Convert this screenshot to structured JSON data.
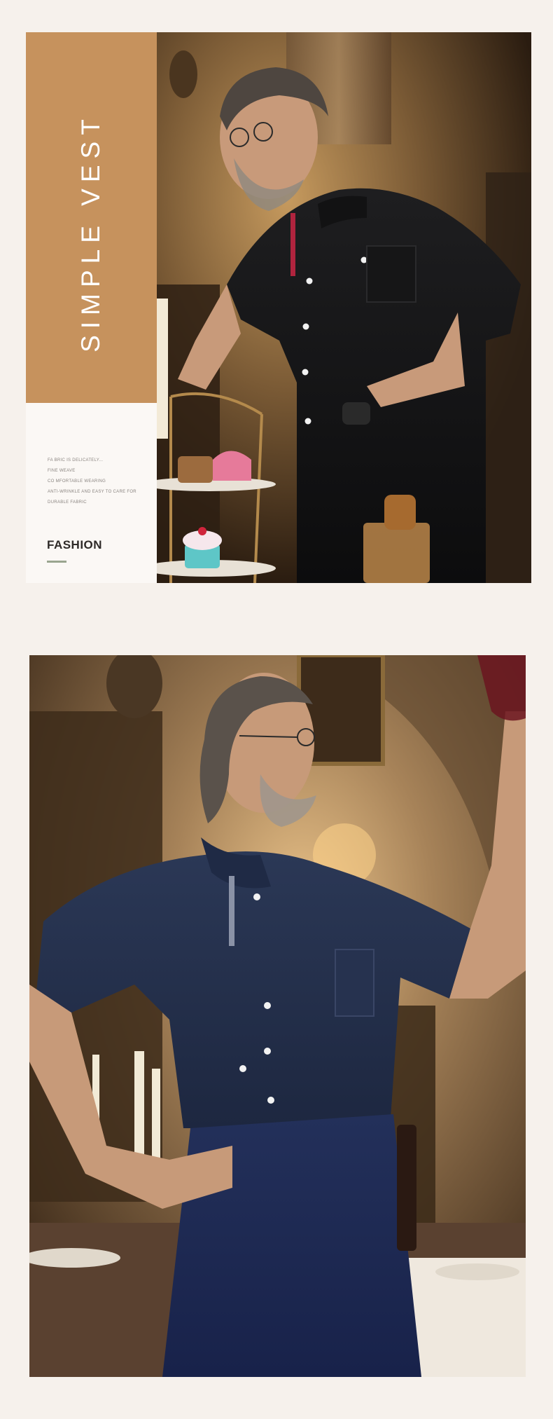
{
  "panel1": {
    "title": "SIMPLE VEST",
    "small_lines": [
      "FA BRIC IS DELICATELY...",
      "FINE WEAVE",
      "CO MFORTABLE WEARING",
      "ANTI-WRINKLE AND EASY TO CARE FOR",
      "DURABLE FABRIC"
    ],
    "label": "FASHION",
    "accent_color": "#c6925d",
    "underline_color": "#9aa58f"
  },
  "panel2": {}
}
